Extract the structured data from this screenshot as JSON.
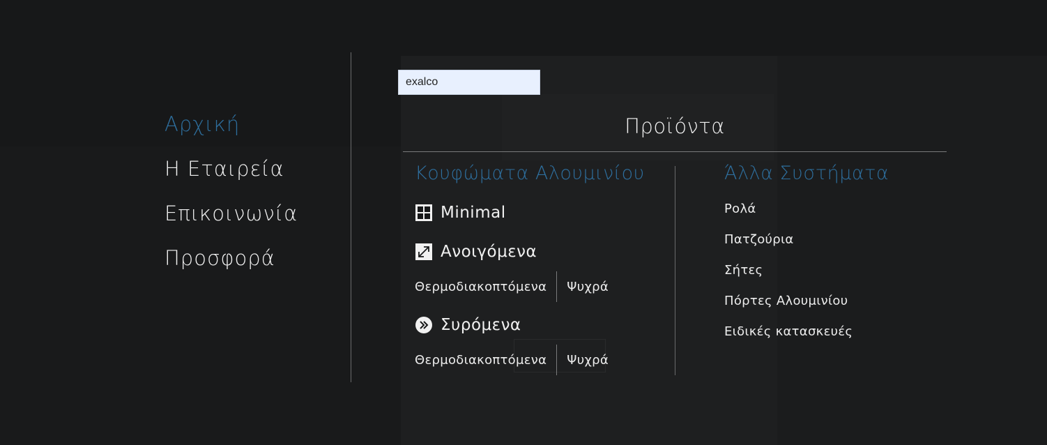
{
  "nav": {
    "items": [
      {
        "label": "Αρχική",
        "active": true
      },
      {
        "label": "Η Εταιρεία",
        "active": false
      },
      {
        "label": "Επικοινωνία",
        "active": false
      },
      {
        "label": "Προσφορά",
        "active": false
      }
    ]
  },
  "search": {
    "value": "exalco"
  },
  "products": {
    "title": "Προϊόντα",
    "left_heading": "Κουφώματα Αλουμινίου",
    "right_heading": "Άλλα Συστήματα",
    "categories": [
      {
        "label": "Minimal",
        "icon": "grid-window-icon"
      },
      {
        "label": "Ανοιγόμενα",
        "icon": "expand-arrows-icon"
      },
      {
        "label": "Συρόμενα",
        "icon": "double-chevron-circle-icon"
      }
    ],
    "subcategories": {
      "opening": [
        "Θερμοδιακοπτόμενα",
        "Ψυχρά"
      ],
      "sliding": [
        "Θερμοδιακοπτόμενα",
        "Ψυχρά"
      ]
    },
    "other_systems": [
      "Ρολά",
      "Πατζούρια",
      "Σήτες",
      "Πόρτες Αλουμινίου",
      "Ειδικές κατασκευές"
    ]
  },
  "colors": {
    "accent": "#2e6f9e",
    "text": "#f1f1f1",
    "background": "#171819"
  }
}
